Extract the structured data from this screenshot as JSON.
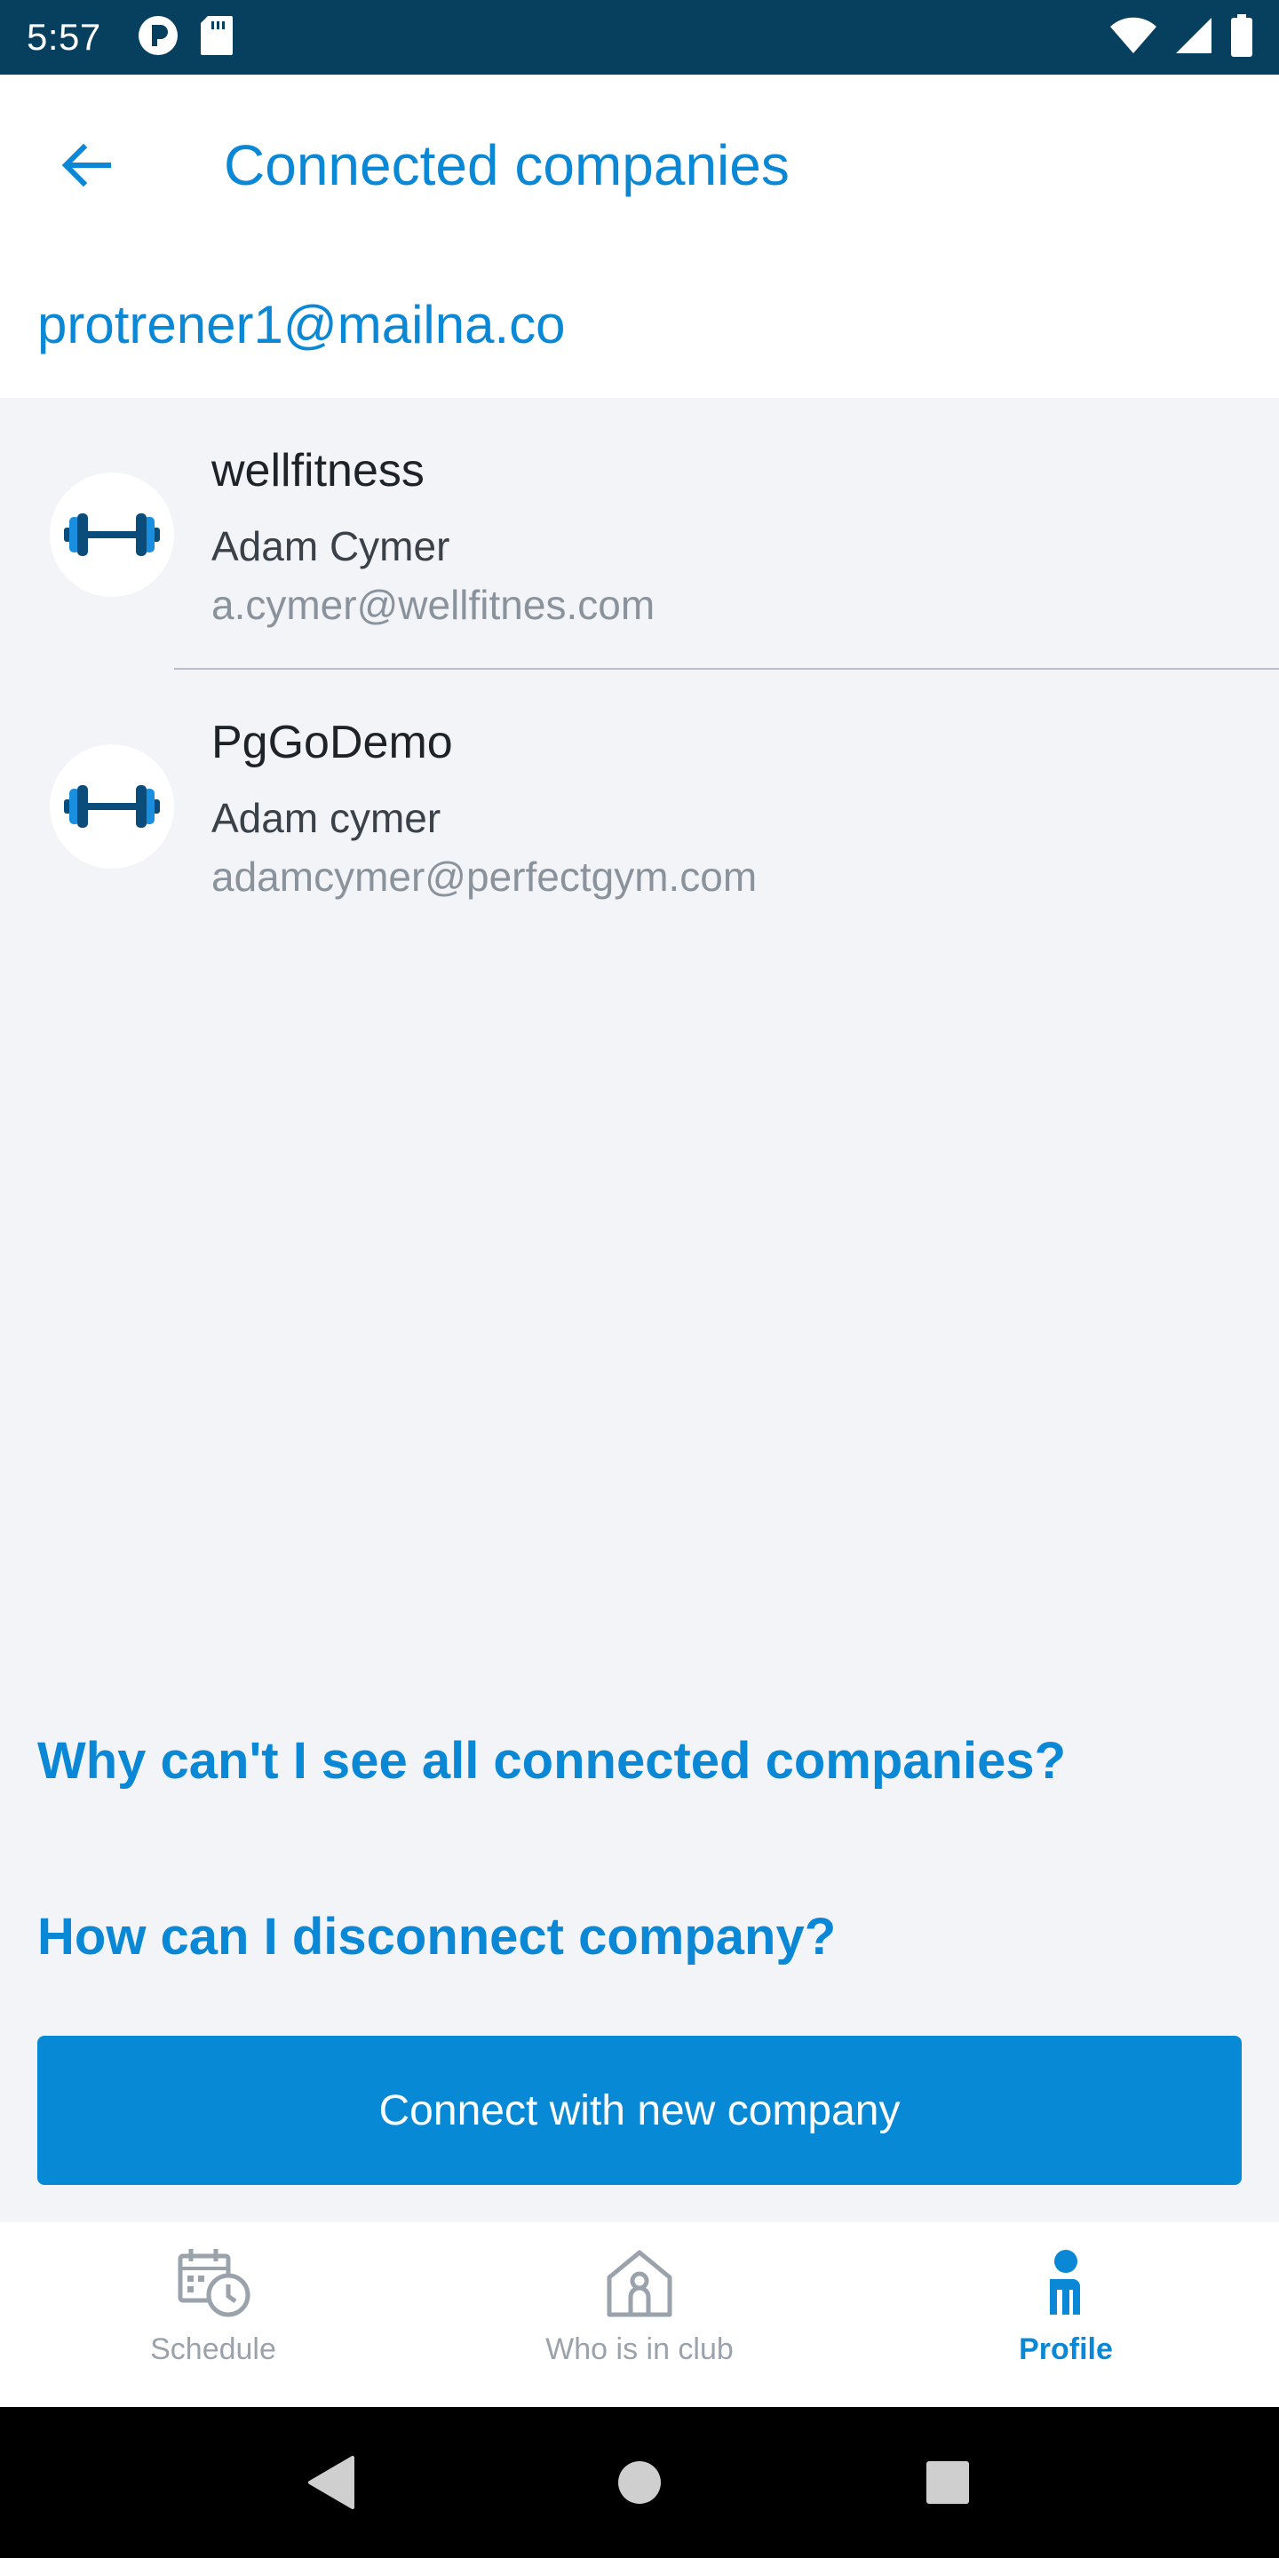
{
  "status_bar": {
    "time": "5:57"
  },
  "header": {
    "title": "Connected companies"
  },
  "account": {
    "email": "protrener1@mailna.co"
  },
  "companies": [
    {
      "name": "wellfitness",
      "contact_name": "Adam Cymer",
      "contact_email": "a.cymer@wellfitnes.com",
      "icon": "dumbbell-icon"
    },
    {
      "name": "PgGoDemo",
      "contact_name": "Adam cymer",
      "contact_email": "adamcymer@perfectgym.com",
      "icon": "dumbbell-icon"
    }
  ],
  "help": {
    "why_cant_see": "Why can't I see all connected companies?",
    "how_disconnect": "How can I disconnect company?"
  },
  "actions": {
    "connect_label": "Connect with new company"
  },
  "bottom_nav": {
    "items": [
      {
        "label": "Schedule",
        "icon": "calendar-clock-icon",
        "active": false
      },
      {
        "label": "Who is in club",
        "icon": "club-house-icon",
        "active": false
      },
      {
        "label": "Profile",
        "icon": "person-icon",
        "active": true
      }
    ]
  },
  "colors": {
    "accent": "#0a88d6",
    "status_bar": "#073f5e",
    "background": "#f2f4f7",
    "inactive": "#9aa3ab"
  }
}
